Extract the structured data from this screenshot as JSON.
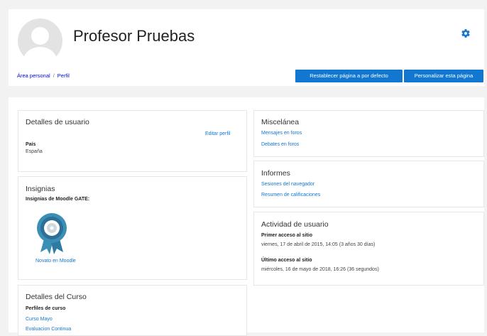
{
  "profile": {
    "name": "Profesor Pruebas"
  },
  "breadcrumb": {
    "items": [
      "Área personal",
      "Perfil"
    ],
    "separator": "/"
  },
  "buttons": {
    "reset": "Restablecer página a por defecto",
    "customize": "Personalizar esta página"
  },
  "user_details": {
    "title": "Detalles de usuario",
    "edit_link": "Editar perfil",
    "country_label": "País",
    "country_value": "España"
  },
  "badges": {
    "title": "Insignias",
    "subtitle": "Insignias de Moodle GATE:",
    "badge_name": "Novato en Moodle"
  },
  "course_details": {
    "title": "Detalles del Curso",
    "profiles_label": "Perfiles de curso",
    "courses": [
      "Curso Mayo",
      "Evaluacion Continua"
    ]
  },
  "misc": {
    "title": "Miscelánea",
    "links": [
      "Mensajes en foros",
      "Debates en foros"
    ]
  },
  "reports": {
    "title": "Informes",
    "links": [
      "Sesiones del navegador",
      "Resumen de calificaciones"
    ]
  },
  "activity": {
    "title": "Actividad de usuario",
    "first_access_label": "Primer acceso al sitio",
    "first_access_value": "viernes, 17 de abril de 2015, 14:05  (3 años 30 días)",
    "last_access_label": "Último acceso al sitio",
    "last_access_value": "miércoles, 16 de mayo de 2018, 16:26  (36 segundos)"
  },
  "colors": {
    "accent": "#1177d1",
    "badge_teal": "#3a8fb7"
  },
  "icons": [
    "user-avatar-icon",
    "gear-icon",
    "badge-medal-icon"
  ]
}
